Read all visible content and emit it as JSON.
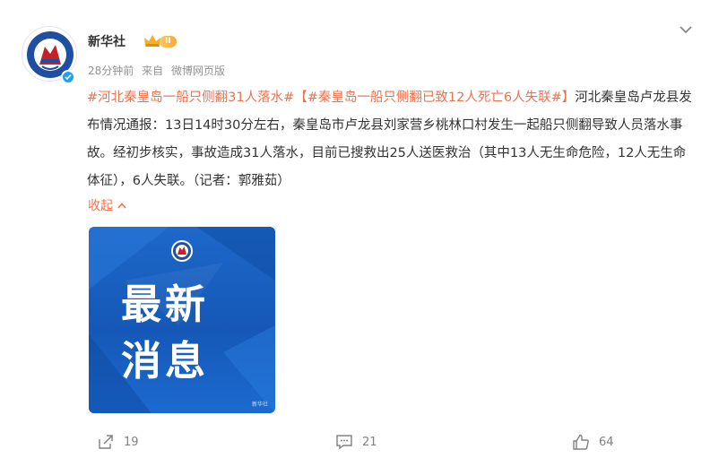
{
  "post": {
    "author": "新华社",
    "vip_level": "II",
    "time": "28分钟前",
    "source_prefix": "来自",
    "source": "微博网页版",
    "topic1": "#河北秦皇岛一船只侧翻31人落水#",
    "topic2": "【#秦皇岛一船只侧翻已致12人死亡6人失联#】",
    "body": "河北秦皇岛卢龙县发布情况通报：13日14时30分左右，秦皇岛市卢龙县刘家营乡桃林口村发生一起船只侧翻导致人员落水事故。经初步核实，事故造成31人落水，目前已搜救出25人送医救治（其中13人无生命危险，12人无生命体征），6人失联。（记者：郭雅茹）",
    "collapse_label": "收起"
  },
  "image": {
    "line1": "最新",
    "line2": "消息",
    "watermark": "新华社"
  },
  "actions": {
    "repost_count": "19",
    "comment_count": "21",
    "like_count": "64"
  },
  "colors": {
    "topic": "#eb7350",
    "image_blue": "#1558b7",
    "verified": "#1da1f2"
  },
  "icons": [
    "xinhua-logo-icon",
    "verified-icon",
    "vip-crown-icon",
    "chevron-down-icon",
    "chevron-up-icon",
    "repost-icon",
    "comment-icon",
    "like-icon"
  ]
}
